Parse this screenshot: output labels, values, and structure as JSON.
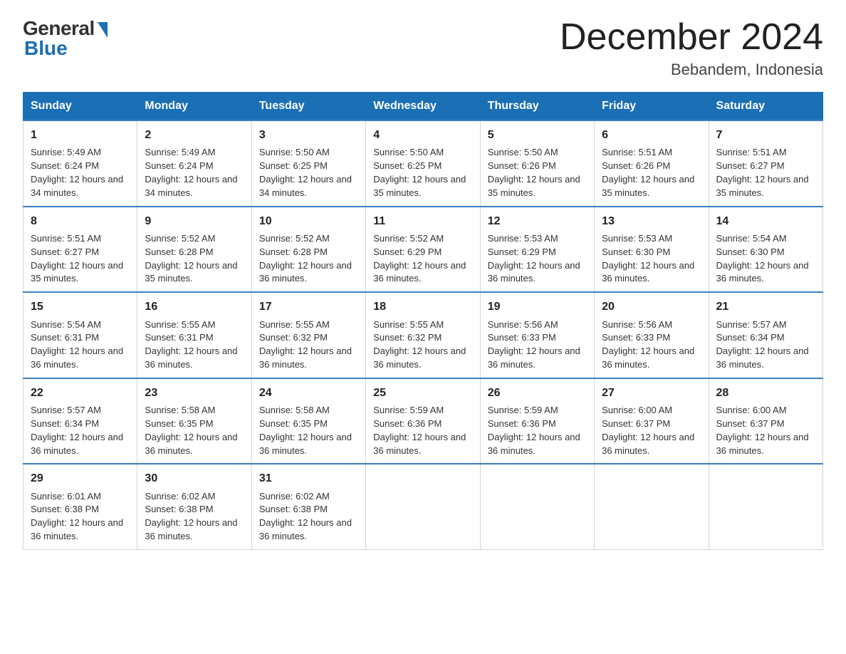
{
  "logo": {
    "general_text": "General",
    "blue_text": "Blue"
  },
  "title": "December 2024",
  "subtitle": "Bebandem, Indonesia",
  "days_of_week": [
    "Sunday",
    "Monday",
    "Tuesday",
    "Wednesday",
    "Thursday",
    "Friday",
    "Saturday"
  ],
  "weeks": [
    [
      {
        "day": "1",
        "sunrise": "5:49 AM",
        "sunset": "6:24 PM",
        "daylight": "12 hours and 34 minutes."
      },
      {
        "day": "2",
        "sunrise": "5:49 AM",
        "sunset": "6:24 PM",
        "daylight": "12 hours and 34 minutes."
      },
      {
        "day": "3",
        "sunrise": "5:50 AM",
        "sunset": "6:25 PM",
        "daylight": "12 hours and 34 minutes."
      },
      {
        "day": "4",
        "sunrise": "5:50 AM",
        "sunset": "6:25 PM",
        "daylight": "12 hours and 35 minutes."
      },
      {
        "day": "5",
        "sunrise": "5:50 AM",
        "sunset": "6:26 PM",
        "daylight": "12 hours and 35 minutes."
      },
      {
        "day": "6",
        "sunrise": "5:51 AM",
        "sunset": "6:26 PM",
        "daylight": "12 hours and 35 minutes."
      },
      {
        "day": "7",
        "sunrise": "5:51 AM",
        "sunset": "6:27 PM",
        "daylight": "12 hours and 35 minutes."
      }
    ],
    [
      {
        "day": "8",
        "sunrise": "5:51 AM",
        "sunset": "6:27 PM",
        "daylight": "12 hours and 35 minutes."
      },
      {
        "day": "9",
        "sunrise": "5:52 AM",
        "sunset": "6:28 PM",
        "daylight": "12 hours and 35 minutes."
      },
      {
        "day": "10",
        "sunrise": "5:52 AM",
        "sunset": "6:28 PM",
        "daylight": "12 hours and 36 minutes."
      },
      {
        "day": "11",
        "sunrise": "5:52 AM",
        "sunset": "6:29 PM",
        "daylight": "12 hours and 36 minutes."
      },
      {
        "day": "12",
        "sunrise": "5:53 AM",
        "sunset": "6:29 PM",
        "daylight": "12 hours and 36 minutes."
      },
      {
        "day": "13",
        "sunrise": "5:53 AM",
        "sunset": "6:30 PM",
        "daylight": "12 hours and 36 minutes."
      },
      {
        "day": "14",
        "sunrise": "5:54 AM",
        "sunset": "6:30 PM",
        "daylight": "12 hours and 36 minutes."
      }
    ],
    [
      {
        "day": "15",
        "sunrise": "5:54 AM",
        "sunset": "6:31 PM",
        "daylight": "12 hours and 36 minutes."
      },
      {
        "day": "16",
        "sunrise": "5:55 AM",
        "sunset": "6:31 PM",
        "daylight": "12 hours and 36 minutes."
      },
      {
        "day": "17",
        "sunrise": "5:55 AM",
        "sunset": "6:32 PM",
        "daylight": "12 hours and 36 minutes."
      },
      {
        "day": "18",
        "sunrise": "5:55 AM",
        "sunset": "6:32 PM",
        "daylight": "12 hours and 36 minutes."
      },
      {
        "day": "19",
        "sunrise": "5:56 AM",
        "sunset": "6:33 PM",
        "daylight": "12 hours and 36 minutes."
      },
      {
        "day": "20",
        "sunrise": "5:56 AM",
        "sunset": "6:33 PM",
        "daylight": "12 hours and 36 minutes."
      },
      {
        "day": "21",
        "sunrise": "5:57 AM",
        "sunset": "6:34 PM",
        "daylight": "12 hours and 36 minutes."
      }
    ],
    [
      {
        "day": "22",
        "sunrise": "5:57 AM",
        "sunset": "6:34 PM",
        "daylight": "12 hours and 36 minutes."
      },
      {
        "day": "23",
        "sunrise": "5:58 AM",
        "sunset": "6:35 PM",
        "daylight": "12 hours and 36 minutes."
      },
      {
        "day": "24",
        "sunrise": "5:58 AM",
        "sunset": "6:35 PM",
        "daylight": "12 hours and 36 minutes."
      },
      {
        "day": "25",
        "sunrise": "5:59 AM",
        "sunset": "6:36 PM",
        "daylight": "12 hours and 36 minutes."
      },
      {
        "day": "26",
        "sunrise": "5:59 AM",
        "sunset": "6:36 PM",
        "daylight": "12 hours and 36 minutes."
      },
      {
        "day": "27",
        "sunrise": "6:00 AM",
        "sunset": "6:37 PM",
        "daylight": "12 hours and 36 minutes."
      },
      {
        "day": "28",
        "sunrise": "6:00 AM",
        "sunset": "6:37 PM",
        "daylight": "12 hours and 36 minutes."
      }
    ],
    [
      {
        "day": "29",
        "sunrise": "6:01 AM",
        "sunset": "6:38 PM",
        "daylight": "12 hours and 36 minutes."
      },
      {
        "day": "30",
        "sunrise": "6:02 AM",
        "sunset": "6:38 PM",
        "daylight": "12 hours and 36 minutes."
      },
      {
        "day": "31",
        "sunrise": "6:02 AM",
        "sunset": "6:38 PM",
        "daylight": "12 hours and 36 minutes."
      },
      null,
      null,
      null,
      null
    ]
  ],
  "labels": {
    "sunrise_prefix": "Sunrise: ",
    "sunset_prefix": "Sunset: ",
    "daylight_prefix": "Daylight: "
  }
}
